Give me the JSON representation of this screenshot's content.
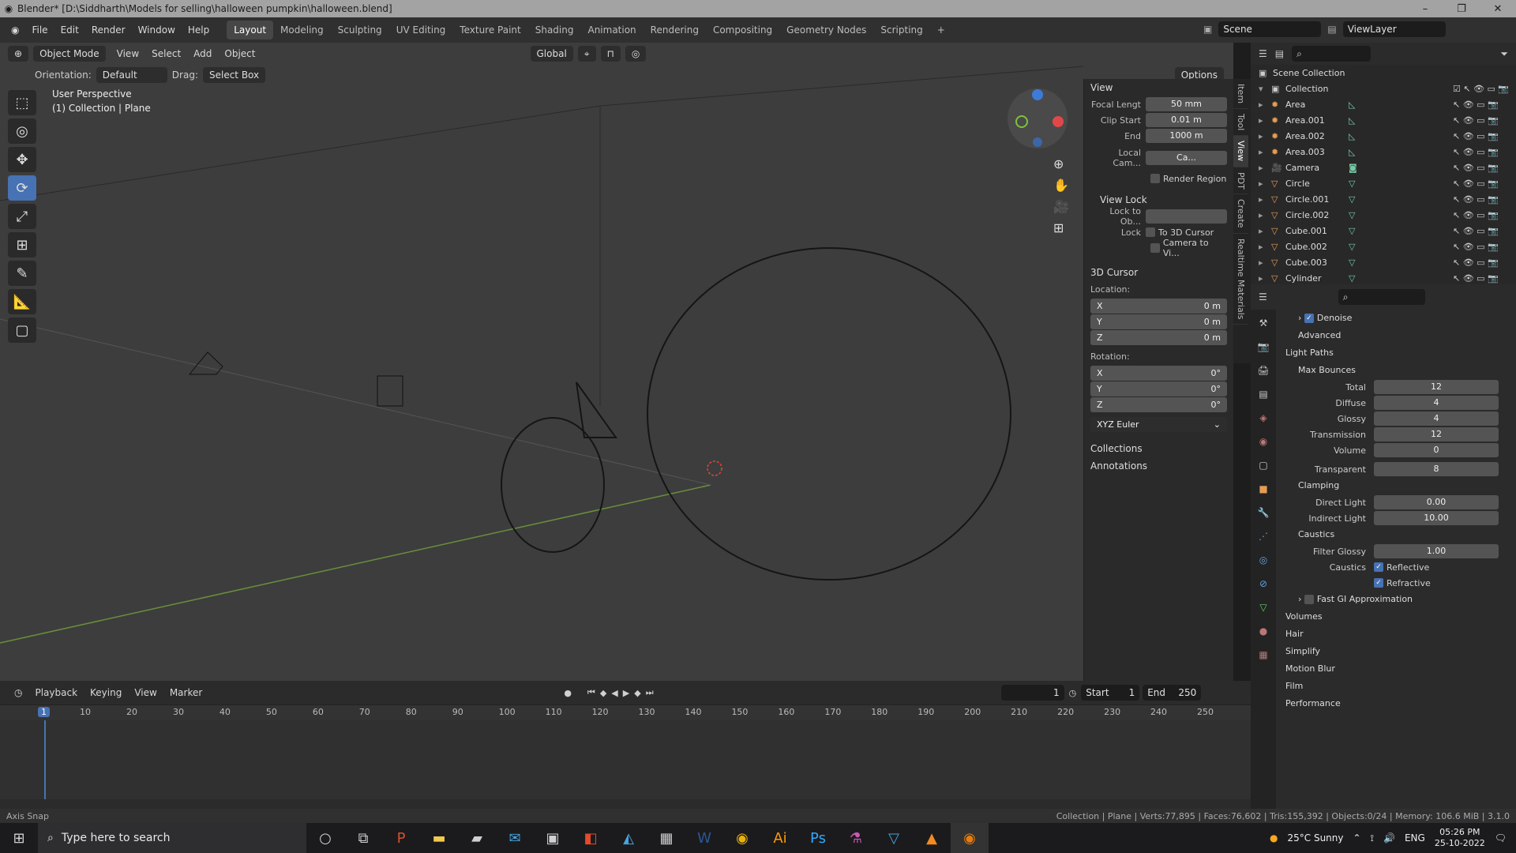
{
  "titlebar": {
    "title": "Blender* [D:\\Siddharth\\Models for selling\\halloween pumpkin\\halloween.blend]"
  },
  "menu": [
    "File",
    "Edit",
    "Render",
    "Window",
    "Help"
  ],
  "workspaces": [
    "Layout",
    "Modeling",
    "Sculpting",
    "UV Editing",
    "Texture Paint",
    "Shading",
    "Animation",
    "Rendering",
    "Compositing",
    "Geometry Nodes",
    "Scripting"
  ],
  "scene": {
    "name": "Scene",
    "viewlayer": "ViewLayer"
  },
  "viewport_header": {
    "mode": "Object Mode",
    "view": "View",
    "select": "Select",
    "add": "Add",
    "object": "Object",
    "orientation_label": "Orientation:",
    "orientation": "Default",
    "drag_label": "Drag:",
    "drag": "Select Box",
    "transform": "Global",
    "options": "Options"
  },
  "viewport_info": {
    "perspective": "User Perspective",
    "collection": "(1) Collection | Plane"
  },
  "npanel": {
    "view_title": "View",
    "focal_label": "Focal Lengt",
    "focal": "50 mm",
    "clip_start_label": "Clip Start",
    "clip_start": "0.01 m",
    "end_label": "End",
    "end": "1000 m",
    "local_cam_label": "Local Cam...",
    "local_cam": "Ca...",
    "render_region": "Render Region",
    "view_lock_title": "View Lock",
    "lock_to_obj": "Lock to Ob...",
    "lock_label": "Lock",
    "to_3d_cursor": "To 3D Cursor",
    "camera_to_view": "Camera to Vi...",
    "cursor_title": "3D Cursor",
    "location_label": "Location:",
    "loc": [
      {
        "k": "X",
        "v": "0 m"
      },
      {
        "k": "Y",
        "v": "0 m"
      },
      {
        "k": "Z",
        "v": "0 m"
      }
    ],
    "rotation_label": "Rotation:",
    "rot": [
      {
        "k": "X",
        "v": "0°"
      },
      {
        "k": "Y",
        "v": "0°"
      },
      {
        "k": "Z",
        "v": "0°"
      }
    ],
    "rot_mode": "XYZ Euler",
    "collections": "Collections",
    "annotations": "Annotations"
  },
  "vtabs": [
    "Item",
    "Tool",
    "View",
    "PDT",
    "Create",
    "Realtime Materials"
  ],
  "outliner": {
    "root": "Scene Collection",
    "collection": "Collection",
    "items": [
      "Area",
      "Area.001",
      "Area.002",
      "Area.003",
      "Camera",
      "Circle",
      "Circle.001",
      "Circle.002",
      "Cube.001",
      "Cube.002",
      "Cube.003",
      "Cylinder"
    ]
  },
  "properties": {
    "denoise": "Denoise",
    "advanced": "Advanced",
    "light_paths": "Light Paths",
    "max_bounces": "Max Bounces",
    "bounces": [
      {
        "l": "Total",
        "v": "12"
      },
      {
        "l": "Diffuse",
        "v": "4"
      },
      {
        "l": "Glossy",
        "v": "4"
      },
      {
        "l": "Transmission",
        "v": "12"
      },
      {
        "l": "Volume",
        "v": "0"
      },
      {
        "l": "Transparent",
        "v": "8"
      }
    ],
    "clamping": "Clamping",
    "direct_light_label": "Direct Light",
    "direct_light": "0.00",
    "indirect_light_label": "Indirect Light",
    "indirect_light": "10.00",
    "caustics": "Caustics",
    "filter_glossy_label": "Filter Glossy",
    "filter_glossy": "1.00",
    "caustics_label": "Caustics",
    "reflective": "Reflective",
    "refractive": "Refractive",
    "fast_gi": "Fast GI Approximation",
    "volumes": "Volumes",
    "hair": "Hair",
    "simplify": "Simplify",
    "motion_blur": "Motion Blur",
    "film": "Film",
    "performance": "Performance"
  },
  "timeline": {
    "playback": "Playback",
    "keying": "Keying",
    "view": "View",
    "marker": "Marker",
    "current_frame": "1",
    "start_label": "Start",
    "start": "1",
    "end_label": "End",
    "end": "250",
    "ticks": [
      "1",
      "10",
      "20",
      "30",
      "40",
      "50",
      "60",
      "70",
      "80",
      "90",
      "100",
      "110",
      "120",
      "130",
      "140",
      "150",
      "160",
      "170",
      "180",
      "190",
      "200",
      "210",
      "220",
      "230",
      "240",
      "250"
    ]
  },
  "status": {
    "left": "Axis Snap",
    "right": "Collection | Plane | Verts:77,895 | Faces:76,602 | Tris:155,392 | Objects:0/24 | Memory: 106.6 MiB | 3.1.0"
  },
  "taskbar": {
    "search": "Type here to search",
    "weather": "25°C  Sunny",
    "lang": "ENG",
    "time": "05:26 PM",
    "date": "25-10-2022"
  }
}
